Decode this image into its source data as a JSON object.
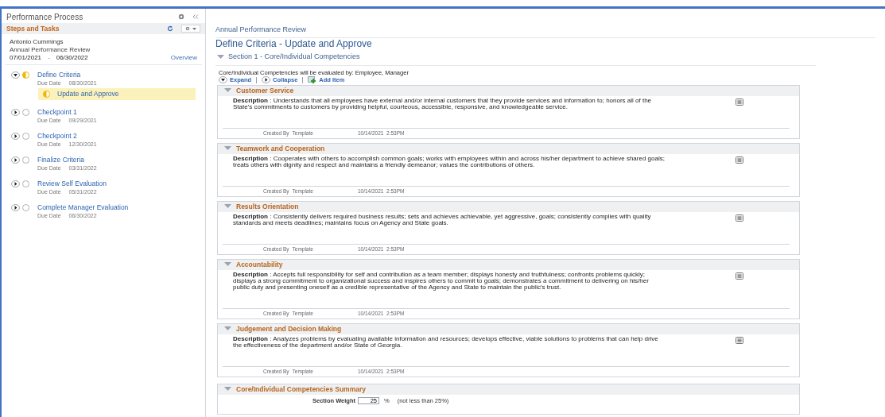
{
  "sidebar": {
    "title": "Performance Process",
    "section_title": "Steps and Tasks",
    "employee": "Antonio Cummings",
    "document": "Annual Performance Review",
    "start_date": "07/01/2021",
    "date_separator": "-",
    "end_date": "06/30/2022",
    "overview_link": "Overview",
    "steps": [
      {
        "label": "Define Criteria",
        "due_label": "Due Date",
        "due_date": "08/30/2021",
        "expanded": true,
        "in_progress": true,
        "children": [
          {
            "label": "Update and Approve",
            "selected": true,
            "in_progress": true
          }
        ]
      },
      {
        "label": "Checkpoint 1",
        "due_label": "Due Date",
        "due_date": "09/29/2021",
        "expanded": false,
        "in_progress": false
      },
      {
        "label": "Checkpoint 2",
        "due_label": "Due Date",
        "due_date": "12/30/2021",
        "expanded": false,
        "in_progress": false
      },
      {
        "label": "Finalize Criteria",
        "due_label": "Due Date",
        "due_date": "03/31/2022",
        "expanded": false,
        "in_progress": false
      },
      {
        "label": "Review Self Evaluation",
        "due_label": "Due Date",
        "due_date": "05/31/2022",
        "expanded": false,
        "in_progress": false
      },
      {
        "label": "Complete Manager Evaluation",
        "due_label": "Due Date",
        "due_date": "06/30/2022",
        "expanded": false,
        "in_progress": false
      }
    ]
  },
  "main": {
    "breadcrumb": "Annual Performance Review",
    "title": "Define Criteria - Update and Approve",
    "section": {
      "title": "Section 1 - Core/Individual Competencies",
      "expanded": true
    },
    "evaluated_by": "Core/Individual Competencies will be evaluated by: Employee, Manager",
    "actions": [
      {
        "label": "Expand",
        "kind": "expand"
      },
      {
        "label": "Collapse",
        "kind": "collapse"
      },
      {
        "label": "Add Item",
        "kind": "add"
      }
    ],
    "items": [
      {
        "title": "Customer Service",
        "expanded": true,
        "description": "**Description** : Understands that all employees have external and/or internal customers that they provide services and information to; honors all of the State's commitments to customers by providing helpful, courteous, accessible, responsive, and knowledgeable service.",
        "created_by_label": "Created By",
        "created_by": "Template",
        "created_at": "10/14/2021  2:53PM"
      },
      {
        "title": "Teamwork and Cooperation",
        "expanded": true,
        "description": "**Description** : Cooperates with others to accomplish common goals; works with employees within and across his/her department to achieve shared goals; treats others with dignity and respect and maintains a friendly demeanor; values the contributions of others.",
        "created_by_label": "Created By",
        "created_by": "Template",
        "created_at": "10/14/2021  2:53PM"
      },
      {
        "title": "Results Orientation",
        "expanded": true,
        "description": "**Description** : Consistently delivers required business results; sets and achieves achievable, yet aggressive, goals; consistently complies with quality standards and meets deadlines; maintains focus on Agency and State goals.",
        "created_by_label": "Created By",
        "created_by": "Template",
        "created_at": "10/14/2021  2:53PM"
      },
      {
        "title": "Accountability",
        "expanded": true,
        "description": "**Description** : Accepts full responsibility for self and contribution as a team member; displays honesty and truthfulness; confronts problems quickly; displays a strong commitment to organizational success and inspires others to commit to goals; demonstrates a commitment to delivering on his/her public duty and presenting oneself as a credible representative of the Agency and State to maintain the public's trust.",
        "created_by_label": "Created By",
        "created_by": "Template",
        "created_at": "10/14/2021  2:53PM"
      },
      {
        "title": "Judgement and Decision Making",
        "expanded": true,
        "description": "**Description** : Analyzes problems by evaluating available information and resources; develops effective, viable solutions to problems that can help drive the effectiveness of the department and/or State of Georgia.",
        "created_by_label": "Created By",
        "created_by": "Template",
        "created_at": "10/14/2021  2:53PM"
      }
    ],
    "summary": {
      "title": "Core/Individual Competencies Summary",
      "expanded": true,
      "weight_label": "Section Weight",
      "weight_value": "25",
      "unit": "%",
      "note": "(not less than 25%)"
    }
  }
}
